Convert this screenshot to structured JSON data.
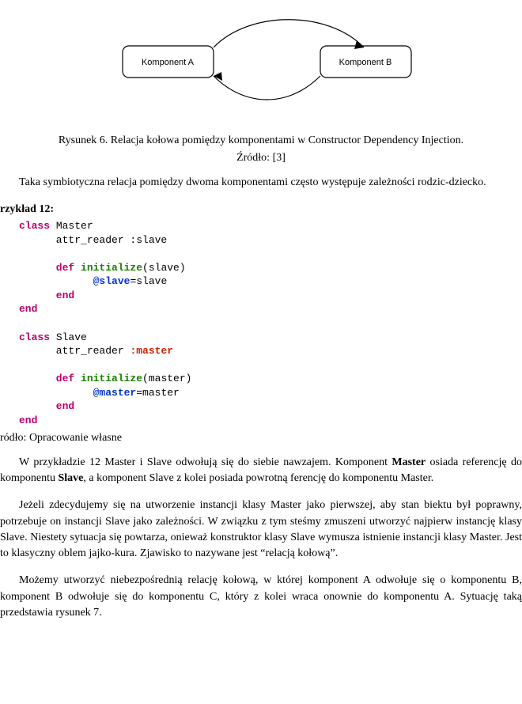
{
  "diagram": {
    "leftBox": "Komponent A",
    "rightBox": "Komponent B"
  },
  "caption": {
    "figureLine": "Rysunek 6. Relacja kołowa pomiędzy komponentami w Constructor Dependency Injection.",
    "sourceLine": "Źródło: [3]"
  },
  "para1": "Taka symbiotyczna relacja pomiędzy dwoma komponentami często występuje zależności rodzic-dziecko.",
  "exampleTitle": "rzykład 12:",
  "code": {
    "l1": "class",
    "l1t": " Master",
    "l2": "      attr_reader :slave",
    "l3d": "      def",
    "l3f": " initialize",
    "l3t": "(slave)",
    "l4iv": "            @slave",
    "l4t": "=slave",
    "l5": "      end",
    "l6": "end",
    "l7": "class",
    "l7t": " Slave",
    "l8a": "      attr_reader ",
    "l8s": ":master",
    "l9d": "      def",
    "l9f": " initialize",
    "l9t": "(master)",
    "l10iv": "            @master",
    "l10t": "=master",
    "l11": "      end",
    "l12": "end"
  },
  "codeSource": "ródło: Opracowanie własne",
  "para2_a": "W przykładzie 12 Master i Slave odwołują się do siebie nawzajem. Komponent ",
  "para2_b": "Master",
  "para2_c": " osiada referencję do komponentu ",
  "para2_d": "Slave",
  "para2_e": ", a komponent Slave z kolei posiada powrotną ferencję do komponentu Master.",
  "para3": "Jeżeli zdecydujemy się na utworzenie instancji klasy Master jako pierwszej, aby stan biektu był poprawny, potrzebuje on instancji Slave jako zależności. W związku z tym steśmy zmuszeni utworzyć najpierw instancję klasy Slave. Niestety sytuacja się powtarza, onieważ konstruktor klasy Slave wymusza istnienie instancji klasy Master. Jest to klasyczny oblem jajko-kura. Zjawisko to  nazywane jest “relacją kołową”.",
  "para4": "Możemy utworzyć niebezpośrednią relację kołową, w której komponent A odwołuje się o komponentu B, komponent B odwołuje się do komponentu C, który z kolei wraca onownie do komponentu A. Sytuację taką przedstawia rysunek 7."
}
